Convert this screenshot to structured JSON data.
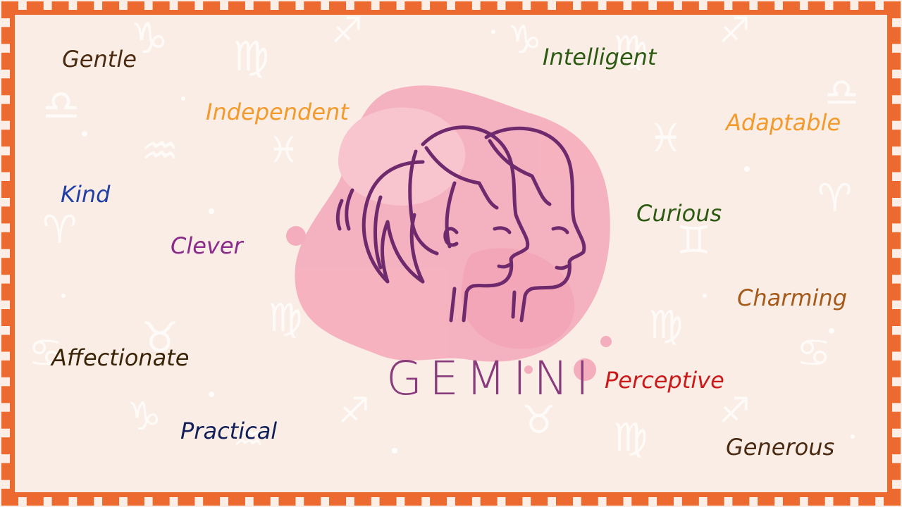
{
  "sign": {
    "name": "GEMINI",
    "icon": "gemini-twins-icon",
    "ink_color": "#6e2a6c",
    "splash_color": "#f2a6b8"
  },
  "colors": {
    "border": "#ec6a2f",
    "background": "#faede5"
  },
  "traits": {
    "gentle": {
      "label": "Gentle",
      "color": "#4a2a10"
    },
    "independent": {
      "label": "Independent",
      "color": "#f39a2d"
    },
    "kind": {
      "label": "Kind",
      "color": "#1f3ea6"
    },
    "clever": {
      "label": "Clever",
      "color": "#8a2a8a"
    },
    "affectionate": {
      "label": "Affectionate",
      "color": "#3a2408"
    },
    "practical": {
      "label": "Practical",
      "color": "#12205a"
    },
    "intelligent": {
      "label": "Intelligent",
      "color": "#2d5a12"
    },
    "adaptable": {
      "label": "Adaptable",
      "color": "#f39a2d"
    },
    "curious": {
      "label": "Curious",
      "color": "#2d5a12"
    },
    "charming": {
      "label": "Charming",
      "color": "#a35a1a"
    },
    "perceptive": {
      "label": "Perceptive",
      "color": "#cc1a1a"
    },
    "generous": {
      "label": "Generous",
      "color": "#4a2a10"
    }
  }
}
